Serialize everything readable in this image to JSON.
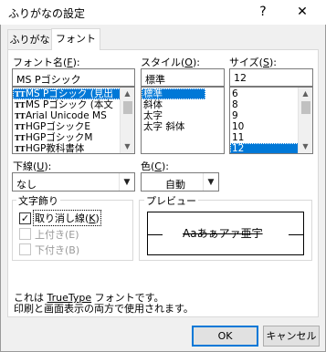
{
  "window": {
    "title": "ふりがなの設定",
    "help_symbol": "?",
    "close_symbol": "✕"
  },
  "tabs": [
    {
      "label": "ふりがな"
    },
    {
      "label": "フォント"
    }
  ],
  "font_name": {
    "label": "フォント名(",
    "accel": "F",
    "label_end": "):",
    "value": "MS Pゴシック",
    "items": [
      {
        "icon": "TT",
        "text": "MS Pゴシック (見出"
      },
      {
        "icon": "TT",
        "text": "MS Pゴシック (本文"
      },
      {
        "icon": "TT",
        "text": "Arial Unicode MS"
      },
      {
        "icon": "TT",
        "text": "HGPゴシックE"
      },
      {
        "icon": "TT",
        "text": "HGPゴシックM"
      },
      {
        "icon": "TT",
        "text": "HGP教科書体"
      }
    ],
    "selected_index": 0
  },
  "style": {
    "label": "スタイル(",
    "accel": "O",
    "label_end": "):",
    "value": "標準",
    "items": [
      "標準",
      "斜体",
      "太字",
      "太字 斜体"
    ],
    "selected_index": 0
  },
  "size": {
    "label": "サイズ(",
    "accel": "S",
    "label_end": "):",
    "value": "12",
    "items": [
      "6",
      "8",
      "9",
      "10",
      "11",
      "12"
    ],
    "selected_index": 5
  },
  "underline": {
    "label": "下線(",
    "accel": "U",
    "label_end": "):",
    "value": "なし"
  },
  "color": {
    "label": "色(",
    "accel": "C",
    "label_end": "):",
    "value": "自動"
  },
  "effects": {
    "label": "文字飾り",
    "strikethrough": {
      "label": "取り消し線(",
      "accel": "K",
      "label_end": ")",
      "checked": true
    },
    "superscript": {
      "label": "上付き(E)",
      "checked": false
    },
    "subscript": {
      "label": "下付き(B)",
      "checked": false
    }
  },
  "preview": {
    "label": "プレビュー",
    "sample": "Aaあぁアァ亜宇"
  },
  "info": {
    "line1_pre": "これは ",
    "line1_link": "TrueType",
    "line1_post": " フォントです。",
    "line2": "印刷と画面表示の両方で使用されます。"
  },
  "buttons": {
    "ok": "OK",
    "cancel": "キャンセル"
  },
  "colors": {
    "selection": "#0078d7",
    "window_bg": "#f0f0f0"
  }
}
